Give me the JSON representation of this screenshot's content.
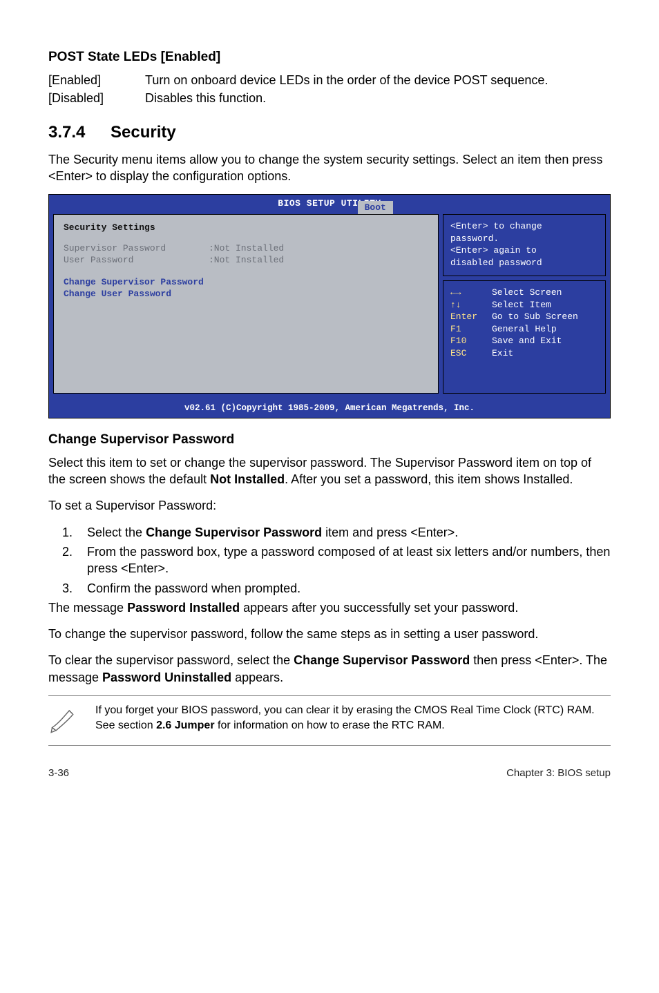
{
  "post_leds": {
    "heading": "POST State LEDs [Enabled]",
    "rows": [
      {
        "term": "[Enabled]",
        "def": "Turn on onboard device LEDs in the order of the device POST sequence."
      },
      {
        "term": "[Disabled]",
        "def": "Disables this function."
      }
    ]
  },
  "section": {
    "number": "3.7.4",
    "title": "Security",
    "intro": "The Security menu items allow you to change the system security settings. Select an item then press <Enter> to display the configuration options."
  },
  "bios": {
    "title": "BIOS SETUP UTILITY",
    "tab": "Boot",
    "left": {
      "heading": "Security Settings",
      "rows": [
        {
          "k": "Supervisor Password",
          "v": ":Not Installed"
        },
        {
          "k": "User Password",
          "v": ":Not Installed"
        }
      ],
      "blue_lines": [
        "Change Supervisor Password",
        "Change User Password"
      ]
    },
    "help": {
      "line1": "<Enter> to change",
      "line2": "password.",
      "line3": "<Enter> again to",
      "line4": "disabled password"
    },
    "keys": [
      {
        "k": "←→",
        "v": "Select Screen"
      },
      {
        "k": "↑↓",
        "v": "Select Item"
      },
      {
        "k": "Enter",
        "v": "Go to Sub Screen"
      },
      {
        "k": "F1",
        "v": "General Help"
      },
      {
        "k": "F10",
        "v": "Save and Exit"
      },
      {
        "k": "ESC",
        "v": "Exit"
      }
    ],
    "footer": "v02.61 (C)Copyright 1985-2009, American Megatrends, Inc."
  },
  "change_sup": {
    "heading": "Change Supervisor Password",
    "p1a": "Select this item to set or change the supervisor password. The Supervisor Password item on top of the screen shows the default ",
    "p1b": "Not Installed",
    "p1c": ". After you set a password, this item shows Installed.",
    "p2": "To set a Supervisor Password:",
    "steps": {
      "s1a": "Select the ",
      "s1b": "Change Supervisor Password",
      "s1c": " item and press <Enter>.",
      "s2": "From the password box, type a password composed of at least six letters and/or numbers, then press <Enter>.",
      "s3": "Confirm the password when prompted."
    },
    "p3a": "The message ",
    "p3b": "Password Installed",
    "p3c": " appears after you successfully set your password.",
    "p4": "To change the supervisor password, follow the same steps as in setting a user password.",
    "p5a": "To clear the supervisor password, select the ",
    "p5b": "Change Supervisor Password",
    "p5c": " then press <Enter>. The message ",
    "p5d": "Password Uninstalled",
    "p5e": " appears."
  },
  "note": {
    "text_a": "If you forget your BIOS password, you can clear it by erasing the CMOS Real Time Clock (RTC) RAM. See section ",
    "text_b": "2.6 Jumper",
    "text_c": " for information on how to erase the RTC RAM."
  },
  "footer": {
    "left": "3-36",
    "right": "Chapter 3: BIOS setup"
  }
}
